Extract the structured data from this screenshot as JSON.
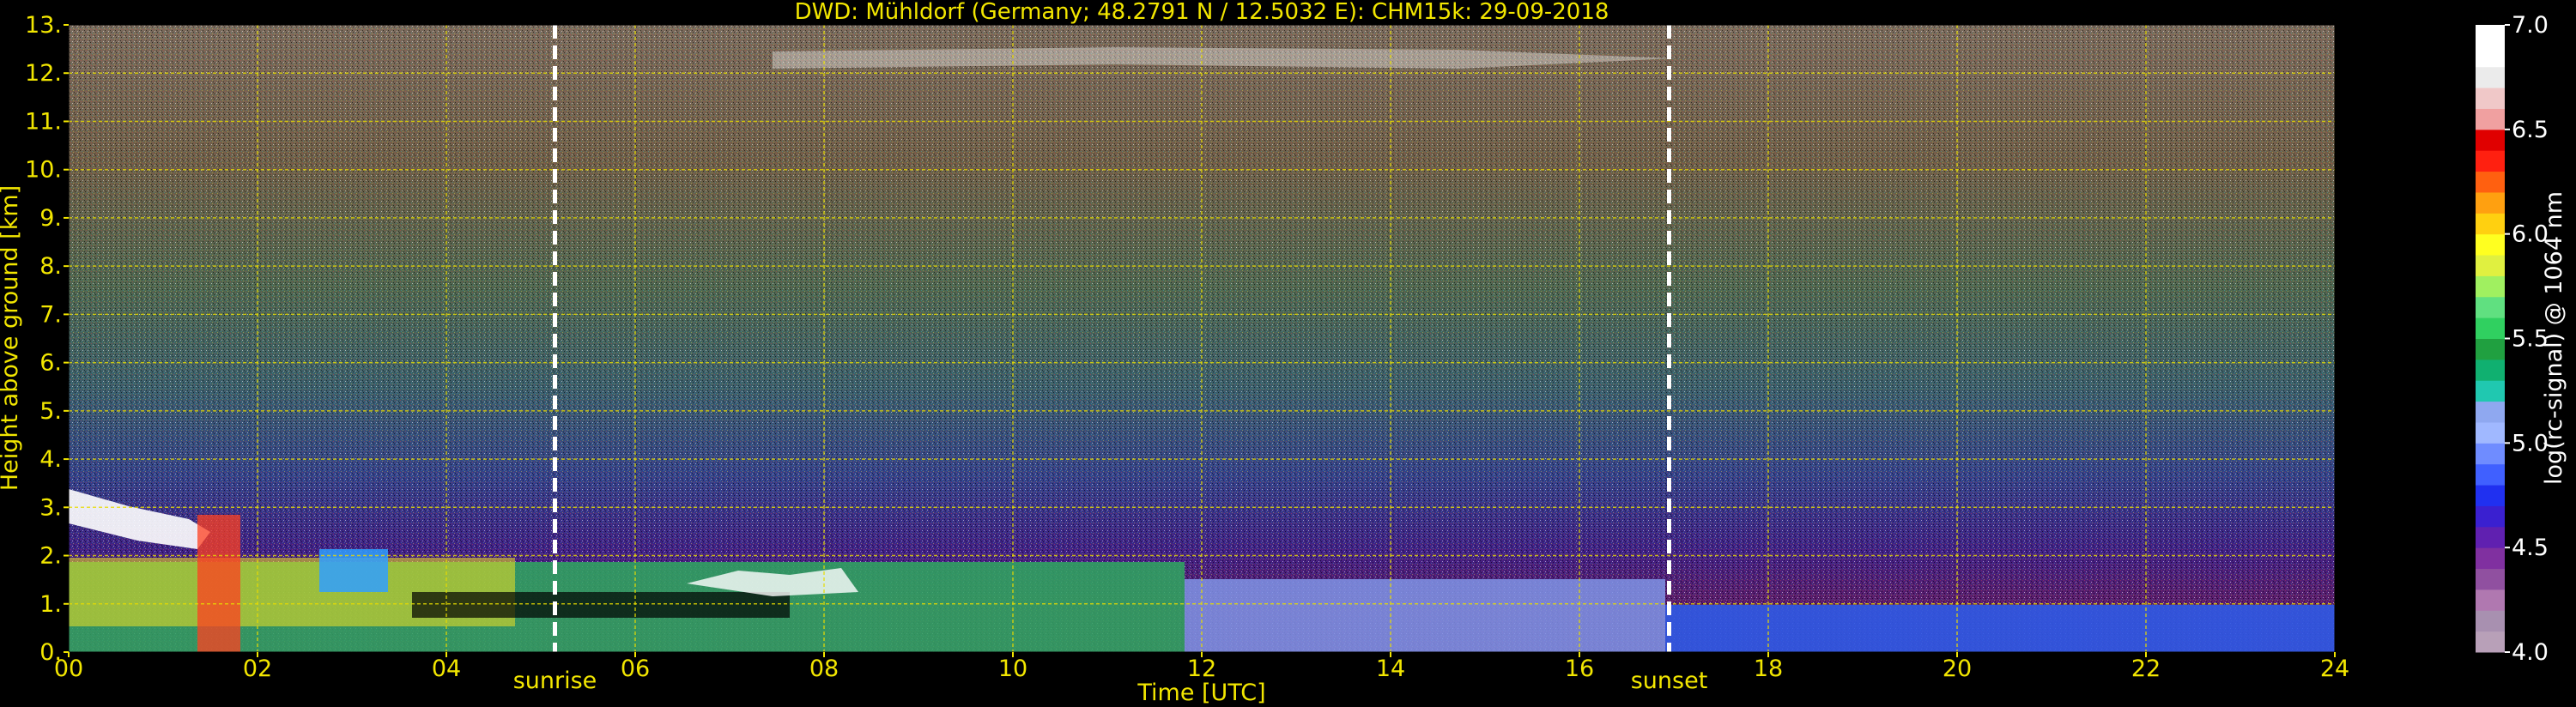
{
  "chart_data": {
    "type": "heatmap",
    "title": "DWD: Mühldorf (Germany; 48.2791 N / 12.5032 E):    CHM15k: 29-09-2018",
    "xlabel": "Time [UTC]",
    "ylabel": "Height above ground [km]",
    "xlim": [
      0,
      24
    ],
    "ylim": [
      0,
      13
    ],
    "x_ticks": [
      0,
      2,
      4,
      6,
      8,
      10,
      12,
      14,
      16,
      18,
      20,
      22,
      24
    ],
    "x_tick_labels": [
      "00",
      "02",
      "04",
      "06",
      "08",
      "10",
      "12",
      "14",
      "16",
      "18",
      "20",
      "22",
      "24"
    ],
    "y_ticks": [
      0,
      1,
      2,
      3,
      4,
      5,
      6,
      7,
      8,
      9,
      10,
      11,
      12,
      13
    ],
    "y_tick_labels": [
      "0.",
      "1.",
      "2.",
      "3.",
      "4.",
      "5.",
      "6.",
      "7.",
      "8.",
      "9.",
      "10.",
      "11.",
      "12.",
      "13."
    ],
    "grid": true,
    "markers": [
      {
        "label": "sunrise",
        "time": 5.15
      },
      {
        "label": "sunset",
        "time": 16.95
      }
    ],
    "colorbar": {
      "label": "log(rc-signal) @ 1064 nm",
      "range": [
        4.0,
        7.0
      ],
      "ticks": [
        4.0,
        4.5,
        5.0,
        5.5,
        6.0,
        6.5,
        7.0
      ],
      "tick_labels": [
        "4.0",
        "4.5",
        "5.0",
        "5.5",
        "6.0",
        "6.5",
        "7.0"
      ],
      "colors": [
        "#b8a0b8",
        "#a890b0",
        "#b078b0",
        "#9050a0",
        "#8030a0",
        "#6020b0",
        "#3a20d0",
        "#2030f0",
        "#4060ff",
        "#6f8cff",
        "#a0b8ff",
        "#8fa8f0",
        "#20c8b0",
        "#10b070",
        "#20a040",
        "#30d060",
        "#60e080",
        "#a0f060",
        "#e0f040",
        "#ffff20",
        "#ffd010",
        "#ffa010",
        "#ff6010",
        "#ff2010",
        "#e00000",
        "#f0a0a0",
        "#f0c8c8",
        "#ebebeb",
        "#ffffff",
        "#ffffff"
      ]
    }
  }
}
